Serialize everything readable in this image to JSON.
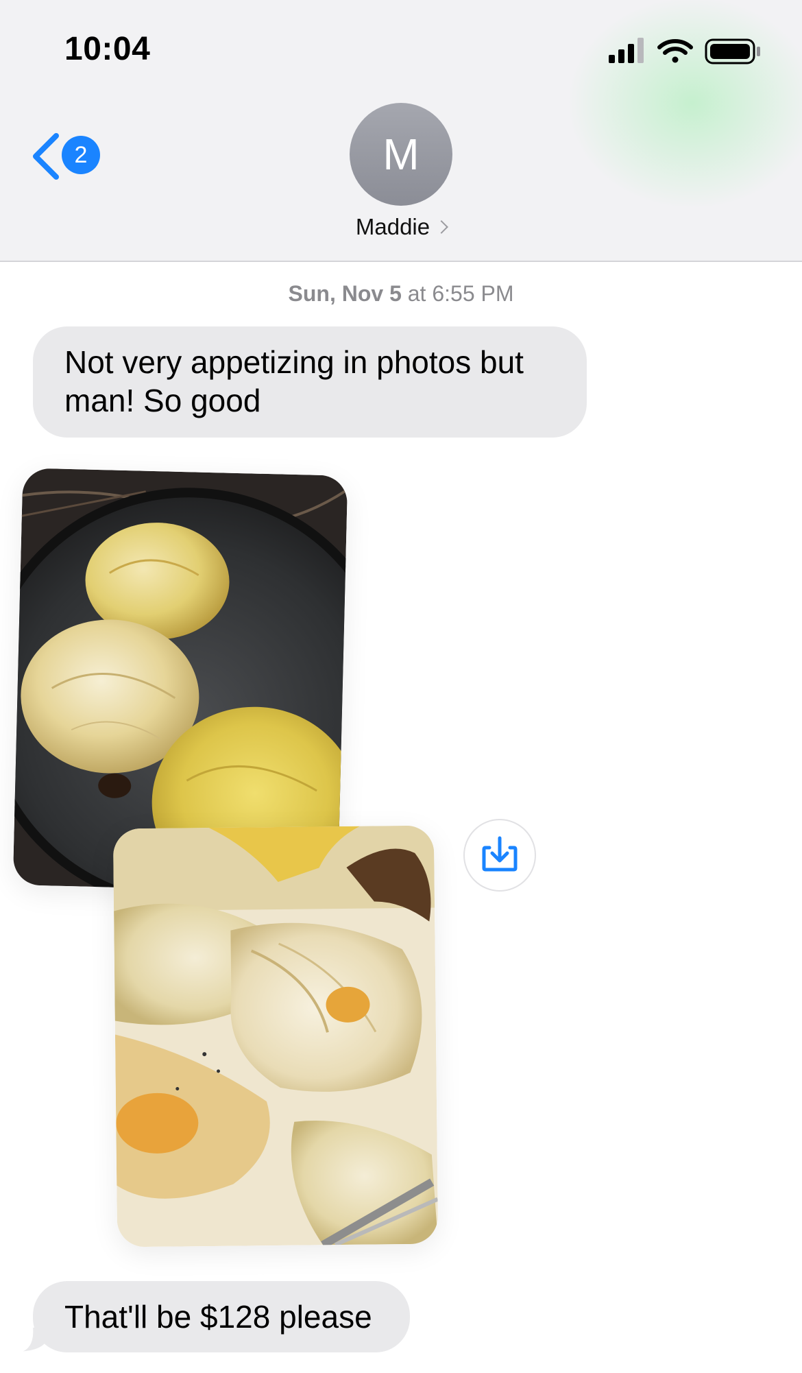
{
  "status_bar": {
    "time": "10:04",
    "icons": [
      "signal-icon",
      "wifi-icon",
      "battery-icon"
    ]
  },
  "nav": {
    "back_badge_count": "2",
    "contact_initial": "M",
    "contact_name": "Maddie"
  },
  "conversation": {
    "timestamp_day": "Sun, Nov 5",
    "timestamp_time": "at 6:55 PM",
    "messages": [
      {
        "type": "text",
        "direction": "incoming",
        "text": "Not very appetizing in photos but man! So good"
      },
      {
        "type": "photo",
        "direction": "incoming",
        "subject": "roasted cabbage in cast iron pan"
      },
      {
        "type": "photo",
        "direction": "incoming",
        "subject": "roasted cabbage on plate"
      },
      {
        "type": "text",
        "direction": "incoming",
        "text": "That'll be $128 please"
      }
    ]
  },
  "colors": {
    "accent": "#1a84ff",
    "incoming_bubble": "#e9e9eb",
    "header_bg": "#f2f2f4",
    "timestamp": "#8a8a8e"
  }
}
